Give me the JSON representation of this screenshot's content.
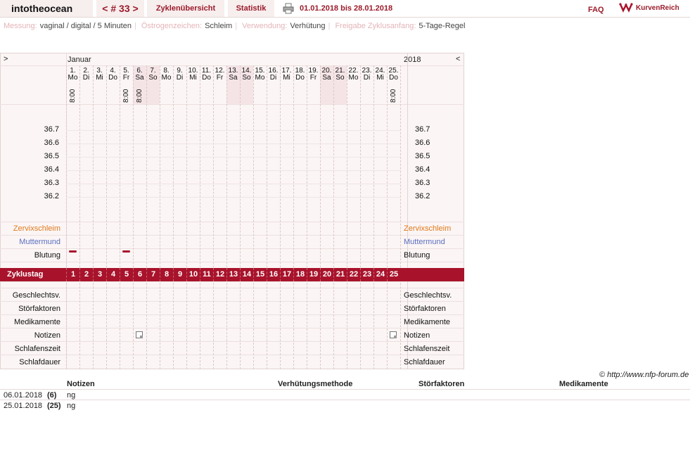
{
  "header": {
    "username": "intotheocean",
    "cycle_nav": "< # 33 >",
    "overview_tab": "Zyklenübersicht",
    "stats_tab": "Statistik",
    "date_range": "01.01.2018 bis 28.01.2018",
    "faq": "FAQ",
    "logo_text": "KurvenReich"
  },
  "info": {
    "measurement_label": "Messung:",
    "measurement_value": "vaginal / digital / 5 Minuten",
    "estrogen_label": "Östrogenzeichen:",
    "estrogen_value": "Schleim",
    "usage_label": "Verwendung:",
    "usage_value": "Verhütung",
    "release_label": "Freigabe Zyklusanfang:",
    "release_value": "5-Tage-Regel"
  },
  "chart": {
    "nav_left": ">",
    "nav_right": "<",
    "month": "Januar",
    "year": "2018",
    "days": [
      {
        "d": "1.",
        "w": "Mo",
        "t": "8:00",
        "we": false
      },
      {
        "d": "2.",
        "w": "Di",
        "t": "",
        "we": false
      },
      {
        "d": "3.",
        "w": "Mi",
        "t": "",
        "we": false
      },
      {
        "d": "4.",
        "w": "Do",
        "t": "",
        "we": false
      },
      {
        "d": "5.",
        "w": "Fr",
        "t": "8:00",
        "we": false
      },
      {
        "d": "6.",
        "w": "Sa",
        "t": "8:00",
        "we": true
      },
      {
        "d": "7.",
        "w": "So",
        "t": "",
        "we": true
      },
      {
        "d": "8.",
        "w": "Mo",
        "t": "",
        "we": false
      },
      {
        "d": "9.",
        "w": "Di",
        "t": "",
        "we": false
      },
      {
        "d": "10.",
        "w": "Mi",
        "t": "",
        "we": false
      },
      {
        "d": "11.",
        "w": "Do",
        "t": "",
        "we": false
      },
      {
        "d": "12.",
        "w": "Fr",
        "t": "",
        "we": false
      },
      {
        "d": "13.",
        "w": "Sa",
        "t": "",
        "we": true
      },
      {
        "d": "14.",
        "w": "So",
        "t": "",
        "we": true
      },
      {
        "d": "15.",
        "w": "Mo",
        "t": "",
        "we": false
      },
      {
        "d": "16.",
        "w": "Di",
        "t": "",
        "we": false
      },
      {
        "d": "17.",
        "w": "Mi",
        "t": "",
        "we": false
      },
      {
        "d": "18.",
        "w": "Do",
        "t": "",
        "we": false
      },
      {
        "d": "19.",
        "w": "Fr",
        "t": "",
        "we": false
      },
      {
        "d": "20.",
        "w": "Sa",
        "t": "",
        "we": true
      },
      {
        "d": "21.",
        "w": "So",
        "t": "",
        "we": true
      },
      {
        "d": "22.",
        "w": "Mo",
        "t": "",
        "we": false
      },
      {
        "d": "23.",
        "w": "Di",
        "t": "",
        "we": false
      },
      {
        "d": "24.",
        "w": "Mi",
        "t": "",
        "we": false
      },
      {
        "d": "25.",
        "w": "Do",
        "t": "8:00",
        "we": false
      }
    ],
    "temps": [
      "36.7",
      "36.6",
      "36.5",
      "36.4",
      "36.3",
      "36.2"
    ],
    "rows_top": [
      "Zervixschleim",
      "Muttermund",
      "Blutung"
    ],
    "cycle_label": "Zyklustag",
    "rows_bottom": [
      "Geschlechtsv.",
      "Störfaktoren",
      "Medikamente",
      "Notizen",
      "Schlafenszeit",
      "Schlafdauer"
    ],
    "bleeding_days": [
      1,
      5
    ],
    "note_days": [
      6,
      25
    ]
  },
  "colors": {
    "accent": "#a8132b",
    "cervical": "#e07a1a",
    "cervix": "#5a6fc0",
    "weekend": "#f5e4e6"
  },
  "footer": {
    "copyright": "© http://www.nfp-forum.de",
    "headers": [
      "Notizen",
      "Verhütungsmethode",
      "Störfaktoren",
      "Medikamente"
    ],
    "rows": [
      {
        "date": "06.01.2018",
        "day": "(6)",
        "note": "ng"
      },
      {
        "date": "25.01.2018",
        "day": "(25)",
        "note": "ng"
      }
    ]
  }
}
